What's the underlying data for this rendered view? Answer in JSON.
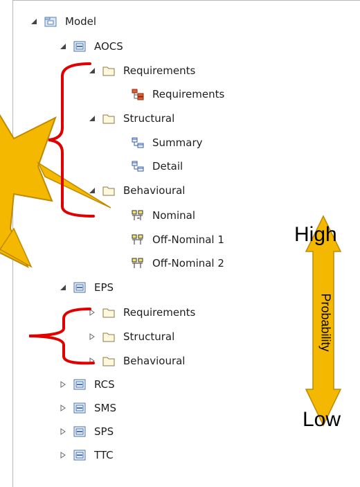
{
  "tree": {
    "root": {
      "label": "Model",
      "icon": "model-package-icon"
    },
    "aocs": {
      "label": "AOCS",
      "icon": "package-icon"
    },
    "aocs_requirements": {
      "label": "Requirements",
      "icon": "folder-icon"
    },
    "aocs_requirements_diagram": {
      "label": "Requirements",
      "icon": "requirements-diagram-icon"
    },
    "aocs_structural": {
      "label": "Structural",
      "icon": "folder-icon"
    },
    "aocs_summary": {
      "label": "Summary",
      "icon": "class-diagram-icon"
    },
    "aocs_detail": {
      "label": "Detail",
      "icon": "class-diagram-icon"
    },
    "aocs_behavioural": {
      "label": "Behavioural",
      "icon": "folder-icon"
    },
    "aocs_nominal": {
      "label": "Nominal",
      "icon": "activity-diagram-icon"
    },
    "aocs_off_nominal_1": {
      "label": "Off-Nominal 1",
      "icon": "activity-diagram-icon"
    },
    "aocs_off_nominal_2": {
      "label": "Off-Nominal 2",
      "icon": "activity-diagram-icon"
    },
    "eps": {
      "label": "EPS",
      "icon": "package-icon"
    },
    "eps_requirements": {
      "label": "Requirements",
      "icon": "folder-icon"
    },
    "eps_structural": {
      "label": "Structural",
      "icon": "folder-icon"
    },
    "eps_behavioural": {
      "label": "Behavioural",
      "icon": "folder-icon"
    },
    "rcs": {
      "label": "RCS",
      "icon": "package-icon"
    },
    "sms": {
      "label": "SMS",
      "icon": "package-icon"
    },
    "sps": {
      "label": "SPS",
      "icon": "package-icon"
    },
    "ttc": {
      "label": "TTC",
      "icon": "package-icon"
    }
  },
  "annotation": {
    "high_label": "High",
    "low_label": "Low",
    "axis_label": "Probability",
    "arrow_color": "#f5b800",
    "arrow_stroke": "#c08a00",
    "bracket_color": "#e00000",
    "star_color": "#f5b800"
  }
}
